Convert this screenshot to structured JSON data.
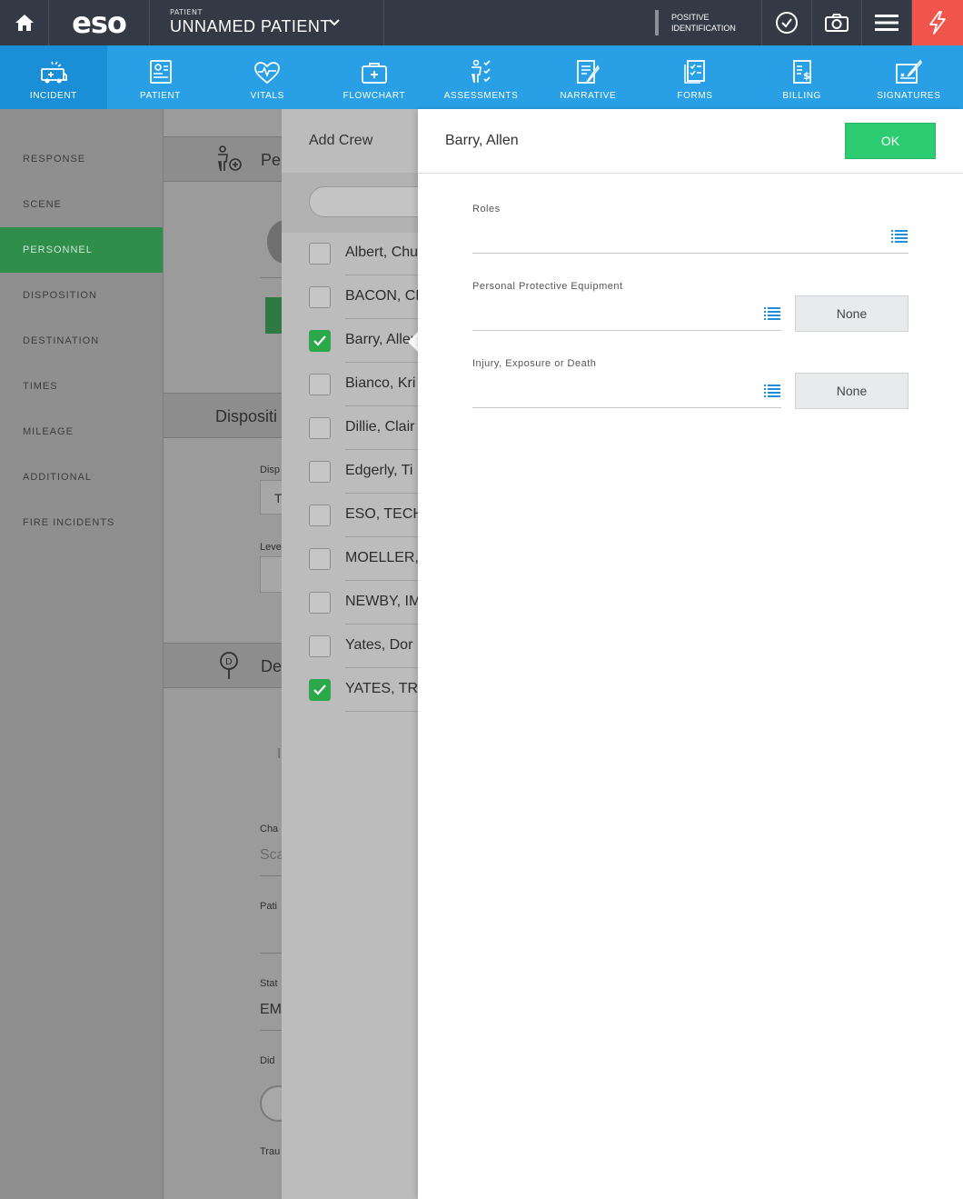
{
  "topbar": {
    "logo": "eso",
    "patient_label": "PATIENT",
    "patient_name": "UNNAMED PATIENT",
    "positive_id_line1": "POSITIVE",
    "positive_id_line2": "IDENTIFICATION"
  },
  "nav": {
    "items": [
      {
        "label": "INCIDENT",
        "icon": "ambulance-icon"
      },
      {
        "label": "PATIENT",
        "icon": "patient-card-icon"
      },
      {
        "label": "VITALS",
        "icon": "heart-pulse-icon"
      },
      {
        "label": "FLOWCHART",
        "icon": "medkit-icon"
      },
      {
        "label": "ASSESSMENTS",
        "icon": "body-check-icon"
      },
      {
        "label": "NARRATIVE",
        "icon": "document-pen-icon"
      },
      {
        "label": "FORMS",
        "icon": "checklist-icon"
      },
      {
        "label": "BILLING",
        "icon": "invoice-icon"
      },
      {
        "label": "SIGNATURES",
        "icon": "signature-icon"
      }
    ]
  },
  "sidebar": {
    "items": [
      {
        "label": "RESPONSE"
      },
      {
        "label": "SCENE"
      },
      {
        "label": "PERSONNEL"
      },
      {
        "label": "DISPOSITION"
      },
      {
        "label": "DESTINATION"
      },
      {
        "label": "TIMES"
      },
      {
        "label": "MILEAGE"
      },
      {
        "label": "ADDITIONAL"
      },
      {
        "label": "FIRE INCIDENTS"
      }
    ]
  },
  "background": {
    "section1": "Pe",
    "section2": "Dispositi",
    "section3": "De",
    "disp_label": "Disp",
    "disp_value": "T",
    "level_label": "Leve",
    "cha_label": "Cha",
    "cha_value": "Sca",
    "pati_label": "Pati",
    "stat_label": "Stat",
    "stat_value": "EM",
    "did_label": "Did",
    "trau_label": "Trau",
    "stray_i": "I"
  },
  "crew": {
    "title": "Add Crew",
    "members": [
      {
        "name": "Albert, Chu",
        "checked": false
      },
      {
        "name": "BACON, CH",
        "checked": false
      },
      {
        "name": "Barry, Allen",
        "checked": true
      },
      {
        "name": "Bianco, Kri",
        "checked": false
      },
      {
        "name": "Dillie, Clair",
        "checked": false
      },
      {
        "name": "Edgerly, Ti",
        "checked": false
      },
      {
        "name": "ESO, TECH",
        "checked": false
      },
      {
        "name": "MOELLER,",
        "checked": false
      },
      {
        "name": "NEWBY, IM",
        "checked": false
      },
      {
        "name": "Yates, Dor",
        "checked": false
      },
      {
        "name": "YATES, TRA",
        "checked": true
      }
    ]
  },
  "detail": {
    "title": "Barry, Allen",
    "ok_label": "OK",
    "roles_label": "Roles",
    "ppe_label": "Personal Protective Equipment",
    "ppe_none": "None",
    "injury_label": "Injury, Exposure or Death",
    "injury_none": "None"
  },
  "colors": {
    "topbar": "#343a45",
    "nav": "#29a0e6",
    "active_green": "#2f8f4a",
    "ok_green": "#2ecc71",
    "alert_red": "#f0544a"
  }
}
